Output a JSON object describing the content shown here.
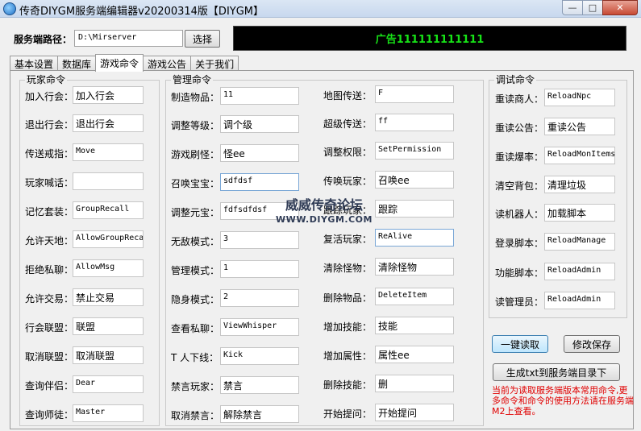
{
  "window": {
    "title": "传奇DIYGM服务端编辑器v20200314版【DIYGM】",
    "minimize": "—",
    "maximize": "□",
    "close": "✕"
  },
  "server": {
    "path_label": "服务端路径：",
    "path_value": "D:\\Mirserver",
    "browse_label": "选择"
  },
  "ad_text": "广告111111111111",
  "tabs": [
    {
      "label": "基本设置"
    },
    {
      "label": "数据库"
    },
    {
      "label": "游戏命令"
    },
    {
      "label": "游戏公告"
    },
    {
      "label": "关于我们"
    }
  ],
  "groups": {
    "player": {
      "title": "玩家命令",
      "fields": [
        {
          "label": "加入行会：",
          "value": "加入行会"
        },
        {
          "label": "退出行会：",
          "value": "退出行会"
        },
        {
          "label": "传送戒指：",
          "value": "Move"
        },
        {
          "label": "玩家喊话：",
          "value": ""
        },
        {
          "label": "记忆套装：",
          "value": "GroupRecall"
        },
        {
          "label": "允许天地：",
          "value": "AllowGroupReca"
        },
        {
          "label": "拒绝私聊：",
          "value": "AllowMsg"
        },
        {
          "label": "允许交易：",
          "value": "禁止交易"
        },
        {
          "label": "行会联盟：",
          "value": "联盟"
        },
        {
          "label": "取消联盟：",
          "value": "取消联盟"
        },
        {
          "label": "查询伴侣：",
          "value": "Dear"
        },
        {
          "label": "查询师徒：",
          "value": "Master"
        }
      ]
    },
    "admin": {
      "title": "管理命令",
      "left": [
        {
          "label": "制造物品：",
          "value": "11"
        },
        {
          "label": "调整等级：",
          "value": "调个级"
        },
        {
          "label": "游戏刷怪：",
          "value": "怪ee"
        },
        {
          "label": "召唤宝宝：",
          "value": "sdfdsf"
        },
        {
          "label": "调整元宝：",
          "value": "fdfsdfdsf"
        },
        {
          "label": "无敌模式：",
          "value": "3"
        },
        {
          "label": "管理模式：",
          "value": "1"
        },
        {
          "label": "隐身模式：",
          "value": "2"
        },
        {
          "label": "查看私聊：",
          "value": "ViewWhisper"
        },
        {
          "label": "T 人下线：",
          "value": "Kick"
        },
        {
          "label": "禁言玩家：",
          "value": "禁言"
        },
        {
          "label": "取消禁言：",
          "value": "解除禁言"
        }
      ],
      "right": [
        {
          "label": "地图传送：",
          "value": "F"
        },
        {
          "label": "超级传送：",
          "value": "ff"
        },
        {
          "label": "调整权限：",
          "value": "SetPermission"
        },
        {
          "label": "传唤玩家：",
          "value": "召唤ee"
        },
        {
          "label": "跟踪玩家：",
          "value": "跟踪"
        },
        {
          "label": "复活玩家：",
          "value": "ReAlive"
        },
        {
          "label": "清除怪物：",
          "value": "清除怪物"
        },
        {
          "label": "删除物品：",
          "value": "DeleteItem"
        },
        {
          "label": "增加技能：",
          "value": "技能"
        },
        {
          "label": "增加属性：",
          "value": "属性ee"
        },
        {
          "label": "删除技能：",
          "value": "删"
        },
        {
          "label": "开始提问：",
          "value": "开始提问"
        }
      ]
    },
    "debug": {
      "title": "调试命令",
      "fields": [
        {
          "label": "重读商人：",
          "value": "ReloadNpc"
        },
        {
          "label": "重读公告：",
          "value": "重读公告"
        },
        {
          "label": "重读爆率：",
          "value": "ReloadMonItems"
        },
        {
          "label": "清空背包：",
          "value": "清理垃圾"
        },
        {
          "label": "读机器人：",
          "value": "加载脚本"
        },
        {
          "label": "登录脚本：",
          "value": "ReloadManage"
        },
        {
          "label": "功能脚本：",
          "value": "ReloadAdmin"
        },
        {
          "label": "读管理员：",
          "value": "ReloadAdmin"
        }
      ]
    }
  },
  "actions": {
    "read": "一键读取",
    "save": "修改保存",
    "generate": "生成txt到服务端目录下"
  },
  "note": "当前为读取服务端版本常用命令,更多命令和命令的使用方法请在服务端M2上查看。",
  "watermark": {
    "main": "威威传奇论坛",
    "sub": "WWW.DIYGM.COM"
  },
  "colors": {
    "ad_background": "#000000",
    "ad_text": "#17e417",
    "note_text": "#e00000"
  }
}
